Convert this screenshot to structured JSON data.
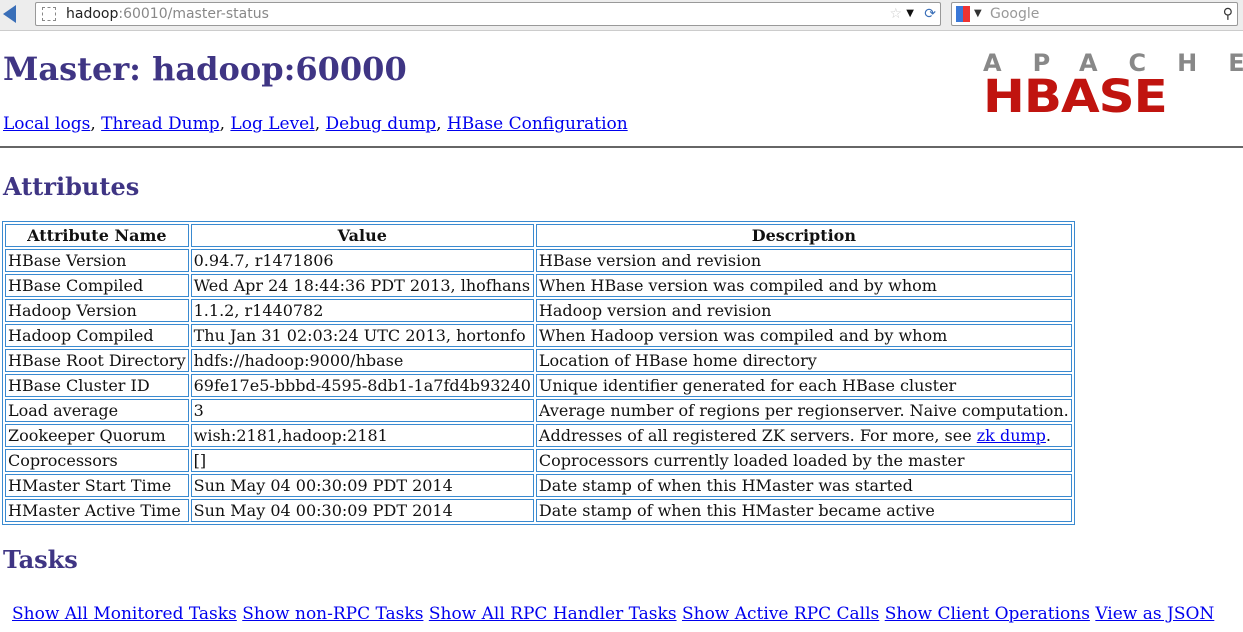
{
  "browser": {
    "url_host": "hadoop",
    "url_rest": ":60010/master-status",
    "search_placeholder": "Google"
  },
  "header": {
    "title": "Master: hadoop:60000",
    "links": [
      "Local logs",
      "Thread Dump",
      "Log Level",
      "Debug dump",
      "HBase Configuration"
    ],
    "logo": {
      "line1": "APACHE",
      "line2": "HBASE"
    }
  },
  "attributes": {
    "heading": "Attributes",
    "columns": [
      "Attribute Name",
      "Value",
      "Description"
    ],
    "rows": [
      [
        "HBase Version",
        "0.94.7, r1471806",
        "HBase version and revision"
      ],
      [
        "HBase Compiled",
        "Wed Apr 24 18:44:36 PDT 2013, lhofhans",
        "When HBase version was compiled and by whom"
      ],
      [
        "Hadoop Version",
        "1.1.2, r1440782",
        "Hadoop version and revision"
      ],
      [
        "Hadoop Compiled",
        "Thu Jan 31 02:03:24 UTC 2013, hortonfo",
        "When Hadoop version was compiled and by whom"
      ],
      [
        "HBase Root Directory",
        "hdfs://hadoop:9000/hbase",
        "Location of HBase home directory"
      ],
      [
        "HBase Cluster ID",
        "69fe17e5-bbbd-4595-8db1-1a7fd4b93240",
        "Unique identifier generated for each HBase cluster"
      ],
      [
        "Load average",
        "3",
        "Average number of regions per regionserver. Naive computation."
      ],
      [
        "Zookeeper Quorum",
        "wish:2181,hadoop:2181",
        "Addresses of all registered ZK servers. For more, see "
      ],
      [
        "Coprocessors",
        "[]",
        "Coprocessors currently loaded loaded by the master"
      ],
      [
        "HMaster Start Time",
        "Sun May 04 00:30:09 PDT 2014",
        "Date stamp of when this HMaster was started"
      ],
      [
        "HMaster Active Time",
        "Sun May 04 00:30:09 PDT 2014",
        "Date stamp of when this HMaster became active"
      ]
    ],
    "zk_link": "zk dump",
    "zk_suffix": "."
  },
  "tasks": {
    "heading": "Tasks",
    "links": [
      "Show All Monitored Tasks",
      "Show non-RPC Tasks",
      "Show All RPC Handler Tasks",
      "Show Active RPC Calls",
      "Show Client Operations",
      "View as JSON"
    ]
  }
}
